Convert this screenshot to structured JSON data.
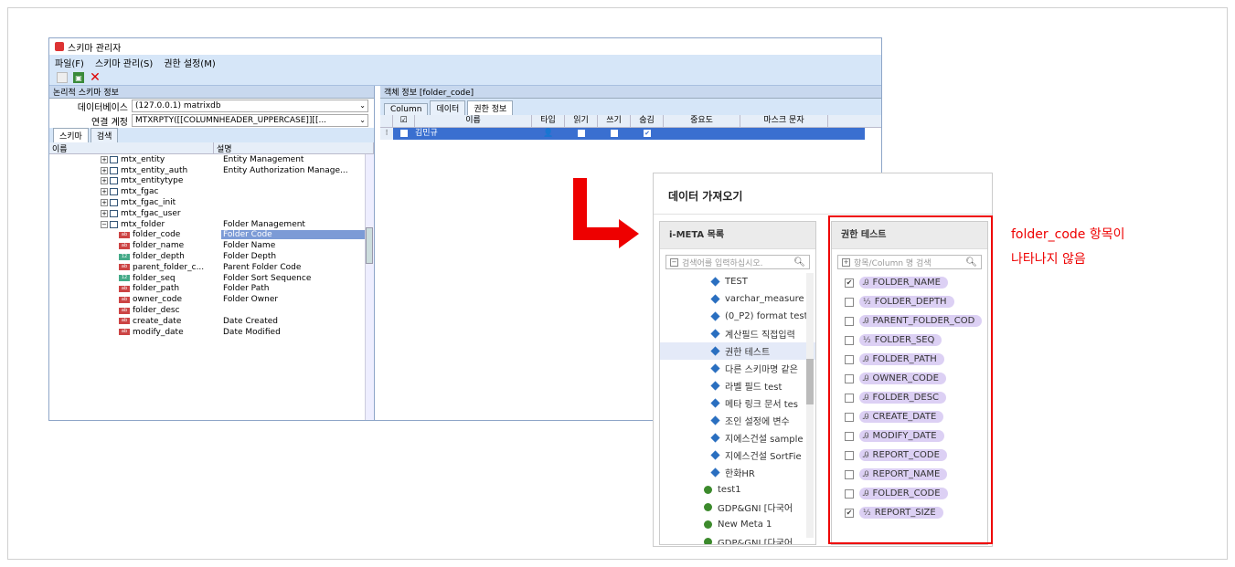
{
  "window": {
    "title": "스키마 관리자",
    "menu": [
      "파일(F)",
      "스키마 관리(S)",
      "권한 설정(M)"
    ]
  },
  "left": {
    "header": "논리적 스키마 정보",
    "db_label": "데이터베이스",
    "db_value": "(127.0.0.1) matrixdb",
    "conn_label": "연결 계정",
    "conn_value": "MTXRPTY([[COLUMNHEADER_UPPERCASE]][[...",
    "tabs": [
      "스키마",
      "검색"
    ],
    "col_name": "이름",
    "col_desc": "설명",
    "rows": [
      {
        "name": "mtx_entity",
        "desc": "Entity Management",
        "kind": "table",
        "indent": 1
      },
      {
        "name": "mtx_entity_auth",
        "desc": "Entity Authorization Manage...",
        "kind": "table",
        "indent": 1
      },
      {
        "name": "mtx_entitytype",
        "desc": "",
        "kind": "table",
        "indent": 1
      },
      {
        "name": "mtx_fgac",
        "desc": "",
        "kind": "table",
        "indent": 1
      },
      {
        "name": "mtx_fgac_init",
        "desc": "",
        "kind": "table",
        "indent": 1
      },
      {
        "name": "mtx_fgac_user",
        "desc": "",
        "kind": "table",
        "indent": 1
      },
      {
        "name": "mtx_folder",
        "desc": "Folder Management",
        "kind": "table",
        "indent": 1
      },
      {
        "name": "folder_code",
        "desc": "Folder Code",
        "kind": "col",
        "indent": 2,
        "selected": true
      },
      {
        "name": "folder_name",
        "desc": "Folder Name",
        "kind": "col",
        "indent": 2
      },
      {
        "name": "folder_depth",
        "desc": "Folder Depth",
        "kind": "num",
        "indent": 2
      },
      {
        "name": "parent_folder_c...",
        "desc": "Parent Folder Code",
        "kind": "col",
        "indent": 2
      },
      {
        "name": "folder_seq",
        "desc": "Folder Sort Sequence",
        "kind": "num",
        "indent": 2
      },
      {
        "name": "folder_path",
        "desc": "Folder Path",
        "kind": "col",
        "indent": 2
      },
      {
        "name": "owner_code",
        "desc": "Folder Owner",
        "kind": "col",
        "indent": 2
      },
      {
        "name": "folder_desc",
        "desc": "",
        "kind": "col",
        "indent": 2
      },
      {
        "name": "create_date",
        "desc": "Date Created",
        "kind": "col",
        "indent": 2
      },
      {
        "name": "modify_date",
        "desc": "Date Modified",
        "kind": "col",
        "indent": 2
      }
    ]
  },
  "right": {
    "header": "객체 정보  [folder_code]",
    "tabs": [
      "Column",
      "데이터",
      "권한 정보"
    ],
    "grid_cols": [
      "☑",
      "이름",
      "타입",
      "읽기",
      "쓰기",
      "숨김",
      "중요도",
      "마스크 문자"
    ],
    "row_name": "김민규"
  },
  "dialog": {
    "title": "데이터 가져오기",
    "left_header": "i-META 목록",
    "left_search": "검색어를 입력하십시오.",
    "meta_items": [
      {
        "label": "TEST",
        "green": false
      },
      {
        "label": "varchar_measure t",
        "green": false
      },
      {
        "label": "(0_P2) format test",
        "green": false
      },
      {
        "label": "계산필드 직접입력",
        "green": false
      },
      {
        "label": "권한 테스트",
        "green": false,
        "selected": true
      },
      {
        "label": "다른 스키마명 같은",
        "green": false
      },
      {
        "label": "라벨 필드 test",
        "green": false
      },
      {
        "label": "메타 링크 문서 tes",
        "green": false
      },
      {
        "label": "조인 설정에 변수",
        "green": false
      },
      {
        "label": "지에스건설 sample",
        "green": false
      },
      {
        "label": "지에스건설 SortFie",
        "green": false
      },
      {
        "label": "한화HR",
        "green": false
      },
      {
        "label": "test1",
        "green": true
      },
      {
        "label": "GDP&GNI [다국어",
        "green": true
      },
      {
        "label": "New Meta 1",
        "green": true
      },
      {
        "label": "GDP&GNI [다국어",
        "green": true
      }
    ],
    "right_header": "권한 테스트",
    "right_search": "항목/Column 명 검색",
    "fields": [
      {
        "label": "FOLDER_NAME",
        "checked": true,
        "num": false
      },
      {
        "label": "FOLDER_DEPTH",
        "checked": false,
        "num": true
      },
      {
        "label": "PARENT_FOLDER_COD",
        "checked": false,
        "num": false
      },
      {
        "label": "FOLDER_SEQ",
        "checked": false,
        "num": true
      },
      {
        "label": "FOLDER_PATH",
        "checked": false,
        "num": false
      },
      {
        "label": "OWNER_CODE",
        "checked": false,
        "num": false
      },
      {
        "label": "FOLDER_DESC",
        "checked": false,
        "num": false
      },
      {
        "label": "CREATE_DATE",
        "checked": false,
        "num": false
      },
      {
        "label": "MODIFY_DATE",
        "checked": false,
        "num": false
      },
      {
        "label": "REPORT_CODE",
        "checked": false,
        "num": false
      },
      {
        "label": "REPORT_NAME",
        "checked": false,
        "num": false
      },
      {
        "label": "FOLDER_CODE",
        "checked": false,
        "num": false
      },
      {
        "label": "REPORT_SIZE",
        "checked": true,
        "num": true
      }
    ]
  },
  "note": {
    "line1": "folder_code 항목이",
    "line2": "나타나지 않음"
  },
  "colors": {
    "accent": "#e00000",
    "selection": "#3a6fd0",
    "pill": "#dcd0f4"
  }
}
